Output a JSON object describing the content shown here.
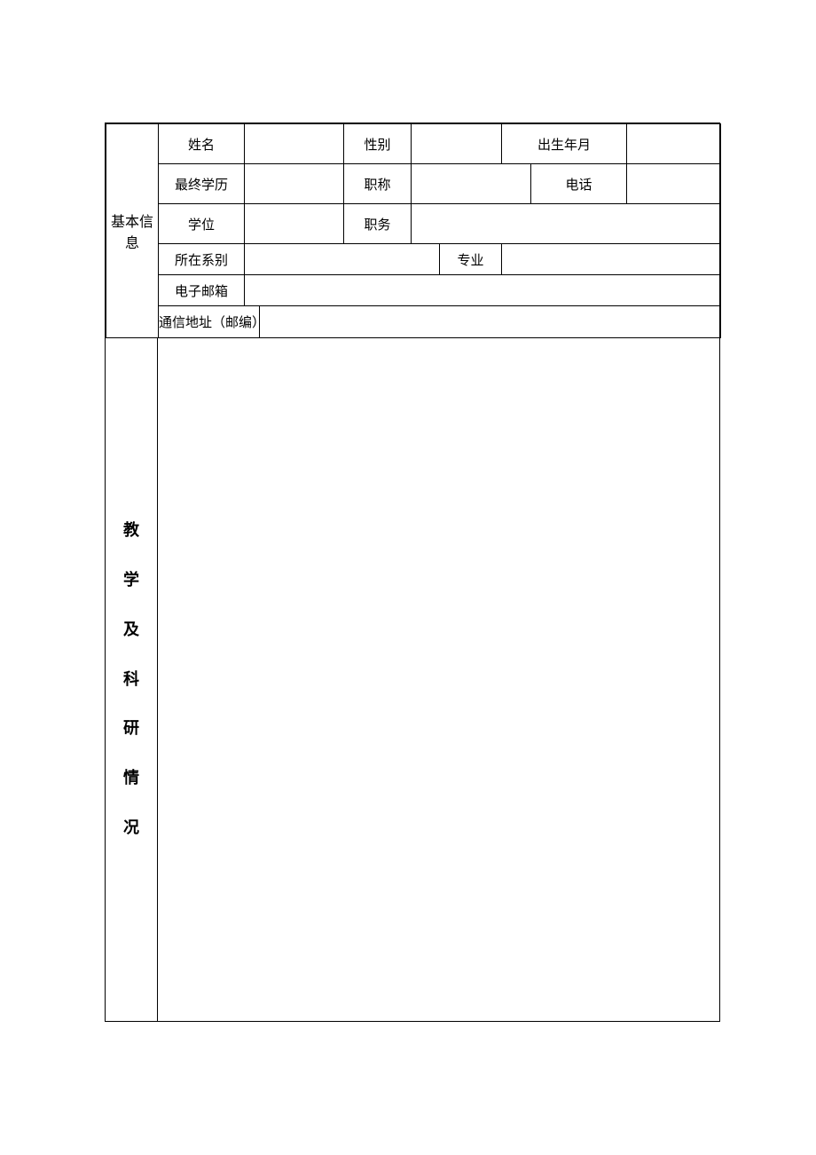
{
  "sections": {
    "basic_info": {
      "label": "基本信息",
      "fields": {
        "name_label": "姓名",
        "name_value": "",
        "gender_label": "性别",
        "gender_value": "",
        "birth_label": "出生年月",
        "birth_value": "",
        "education_label": "最终学历",
        "education_value": "",
        "title_label": "职称",
        "title_value": "",
        "phone_label": "电话",
        "phone_value": "",
        "degree_label": "学位",
        "degree_value": "",
        "position_label": "职务",
        "position_value": "",
        "department_label": "所在系别",
        "department_value": "",
        "major_label": "专业",
        "major_value": "",
        "email_label": "电子邮箱",
        "email_value": "",
        "address_label": "通信地址（邮编）",
        "address_value": ""
      }
    },
    "teaching_research": {
      "label_chars": [
        "教",
        "学",
        "及",
        "科",
        "研",
        "情",
        "况"
      ],
      "content": ""
    }
  }
}
